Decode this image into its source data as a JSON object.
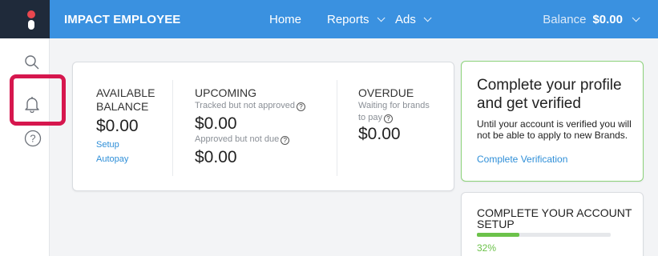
{
  "header": {
    "brand": "IMPACT EMPLOYEE",
    "nav": [
      {
        "label": "Home",
        "has_dropdown": false
      },
      {
        "label": "Reports",
        "has_dropdown": true
      },
      {
        "label": "Ads",
        "has_dropdown": true
      }
    ],
    "balance_label": "Balance",
    "balance_value": "$0.00"
  },
  "sidebar": {
    "items": [
      {
        "icon": "search-icon"
      },
      {
        "icon": "bell-icon",
        "highlighted": true
      },
      {
        "icon": "help-icon",
        "glyph": "?"
      }
    ]
  },
  "balances": {
    "available": {
      "heading": "AVAILABLE BALANCE",
      "amount": "$0.00",
      "links": [
        "Setup",
        "Autopay"
      ]
    },
    "upcoming": {
      "heading": "UPCOMING",
      "rows": [
        {
          "label": "Tracked but not approved",
          "amount": "$0.00"
        },
        {
          "label": "Approved but not due",
          "amount": "$0.00"
        }
      ]
    },
    "overdue": {
      "heading": "OVERDUE",
      "label_line1": "Waiting for brands",
      "label_line2": "to pay",
      "amount": "$0.00"
    },
    "help_glyph": "?"
  },
  "verify_card": {
    "title": "Complete your profile and get verified",
    "body": "Until your account is verified you will not be able to apply to new Brands.",
    "link": "Complete Verification"
  },
  "setup_card": {
    "title": "COMPLETE YOUR ACCOUNT SETUP",
    "progress": 0.32,
    "progress_text": "32%"
  },
  "colors": {
    "topbar": "#3a91e0",
    "highlight": "#d6174e",
    "accent_green": "#6cc24a",
    "link": "#2f8fd8"
  }
}
